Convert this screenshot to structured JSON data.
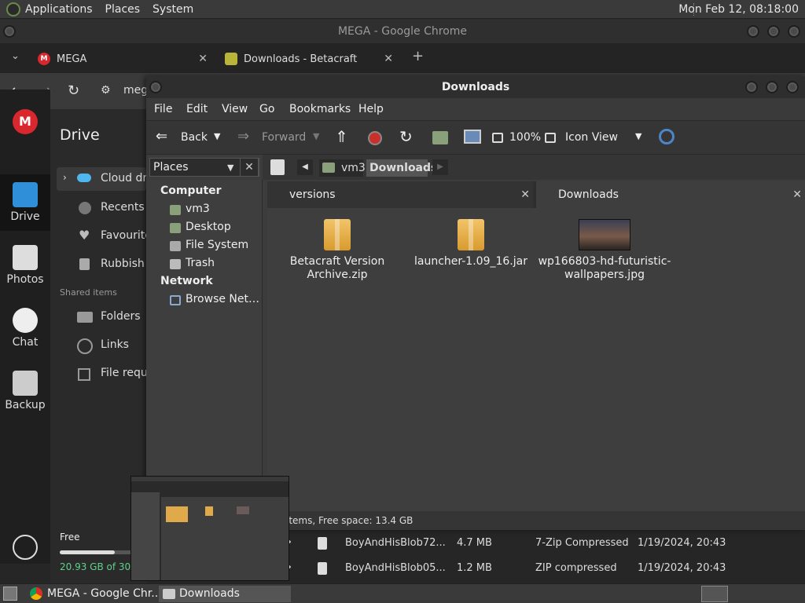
{
  "topbar": {
    "menus": [
      "Applications",
      "Places",
      "System"
    ],
    "clock": "Mon Feb 12, 08:18:00"
  },
  "chrome": {
    "title": "MEGA - Google Chrome",
    "tabs": [
      {
        "label": "MEGA",
        "close": "✕"
      },
      {
        "label": "Downloads - Betacraft",
        "close": "✕"
      }
    ],
    "new_tab": "+",
    "url_partial": "meg"
  },
  "mega": {
    "logo": "M",
    "rail": [
      "Drive",
      "Photos",
      "Chat",
      "Backup"
    ],
    "drive_title": "Drive",
    "nav": [
      "Cloud dri",
      "Recents",
      "Favourite",
      "Rubbish b"
    ],
    "shared_label": "Shared items",
    "shared": [
      "Folders",
      "Links",
      "File reque"
    ],
    "storage": {
      "label": "Free",
      "used_text": "20.93 GB of 30 G",
      "used_fraction": 0.7
    },
    "rows": [
      {
        "name": "BoyAndHisBlob72...",
        "size": "4.7 MB",
        "type": "7-Zip Compressed",
        "date": "1/19/2024, 20:43"
      },
      {
        "name": "BoyAndHisBlob05...",
        "size": "1.2 MB",
        "type": "ZIP compressed",
        "date": "1/19/2024, 20:43"
      }
    ]
  },
  "caja": {
    "title": "Downloads",
    "menu": [
      "File",
      "Edit",
      "View",
      "Go",
      "Bookmarks",
      "Help"
    ],
    "toolbar": {
      "back": "Back",
      "forward": "Forward",
      "zoom": "100%",
      "view": "Icon View"
    },
    "places_label": "Places",
    "sidebar": {
      "computer_header": "Computer",
      "computer_items": [
        "vm3",
        "Desktop",
        "File System",
        "Trash"
      ],
      "network_header": "Network",
      "network_items": [
        "Browse Net…"
      ]
    },
    "path": [
      "vm3",
      "Downloads"
    ],
    "tabs": [
      "versions",
      "Downloads"
    ],
    "files": [
      {
        "name": "Betacraft Version Archive.zip",
        "icon": "zip-archive-icon"
      },
      {
        "name": "launcher-1.09_16.jar",
        "icon": "jar-archive-icon"
      },
      {
        "name": "wp166803-hd-futuristic-wallpapers.jpg",
        "icon": "image-thumbnail"
      }
    ],
    "status": "items, Free space: 13.4 GB"
  },
  "taskbar": {
    "items": [
      "MEGA - Google Chr...",
      "Downloads"
    ]
  }
}
